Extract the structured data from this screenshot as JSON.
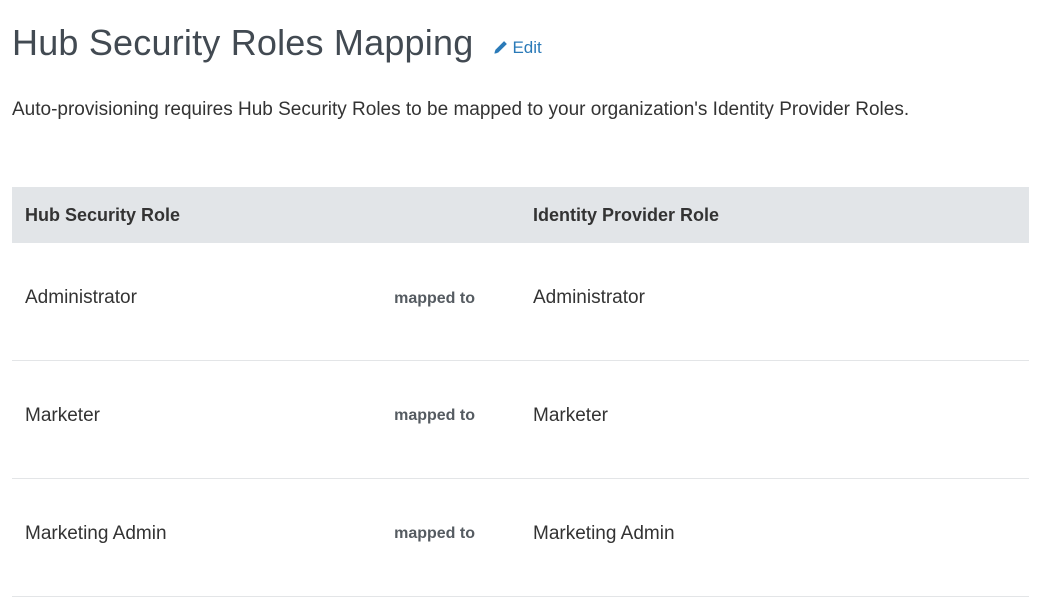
{
  "header": {
    "title": "Hub Security Roles Mapping",
    "edit_label": "Edit",
    "edit_icon": "pencil-icon"
  },
  "description": "Auto-provisioning requires Hub Security Roles to be mapped to your organization's Identity Provider Roles.",
  "table": {
    "columns": {
      "hub_role": "Hub Security Role",
      "mapping": "",
      "idp_role": "Identity Provider Role"
    },
    "rows": [
      {
        "hub_role": "Administrator",
        "mapping": "mapped to",
        "idp_role": "Administrator"
      },
      {
        "hub_role": "Marketer",
        "mapping": "mapped to",
        "idp_role": "Marketer"
      },
      {
        "hub_role": "Marketing Admin",
        "mapping": "mapped to",
        "idp_role": "Marketing Admin"
      }
    ]
  },
  "colors": {
    "link": "#2a7ab8",
    "header_bg": "#e2e5e8",
    "title": "#424a52"
  }
}
